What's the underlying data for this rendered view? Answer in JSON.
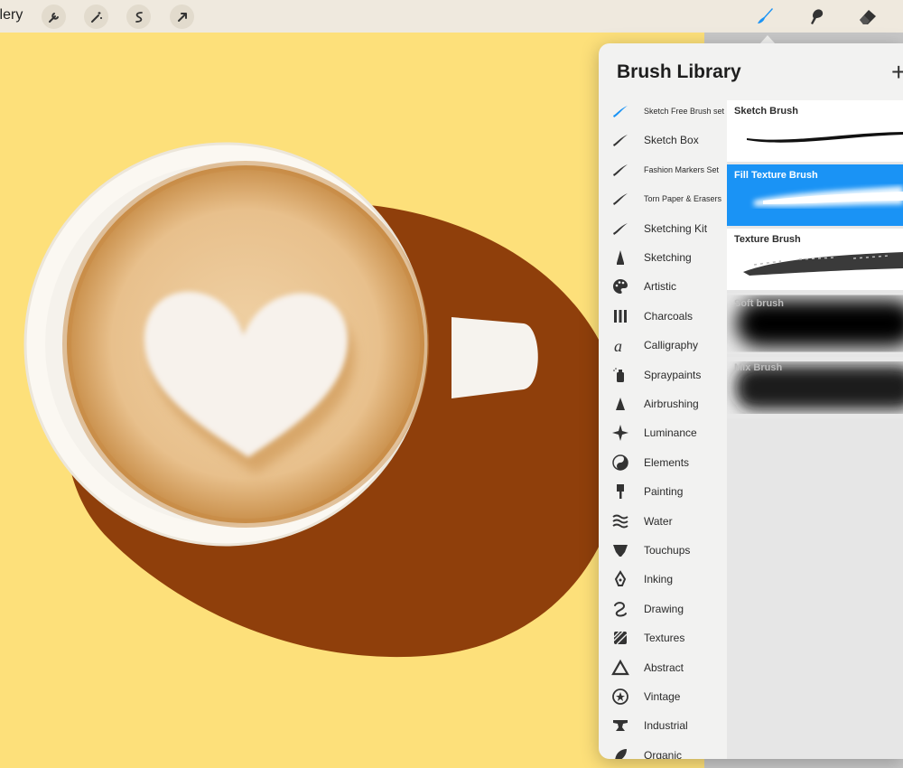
{
  "toolbar": {
    "gallery_label": "llery",
    "tools": [
      "wrench-icon",
      "magic-wand-icon",
      "selection-icon",
      "transform-arrow-icon"
    ],
    "right_tools": [
      "brush-icon",
      "smudge-icon",
      "eraser-icon"
    ],
    "active_color": "#1a93f5"
  },
  "panel": {
    "title": "Brush Library",
    "add_label": "+",
    "categories": [
      {
        "label": "Sketch Free Brush set",
        "icon": "brush-stroke-icon",
        "active": true
      },
      {
        "label": "Sketch Box",
        "icon": "brush-stroke-icon"
      },
      {
        "label": "Fashion Markers Set",
        "icon": "brush-stroke-icon"
      },
      {
        "label": "Torn Paper & Erasers",
        "icon": "brush-stroke-icon"
      },
      {
        "label": "Sketching Kit",
        "icon": "brush-stroke-icon"
      },
      {
        "label": "Sketching",
        "icon": "pencil-icon"
      },
      {
        "label": "Artistic",
        "icon": "palette-icon"
      },
      {
        "label": "Charcoals",
        "icon": "charcoal-icon"
      },
      {
        "label": "Calligraphy",
        "icon": "calligraphy-icon"
      },
      {
        "label": "Spraypaints",
        "icon": "spray-can-icon"
      },
      {
        "label": "Airbrushing",
        "icon": "airbrush-icon"
      },
      {
        "label": "Luminance",
        "icon": "sparkle-icon"
      },
      {
        "label": "Elements",
        "icon": "yin-yang-icon"
      },
      {
        "label": "Painting",
        "icon": "paintbrush-icon"
      },
      {
        "label": "Water",
        "icon": "waves-icon"
      },
      {
        "label": "Touchups",
        "icon": "touchup-icon"
      },
      {
        "label": "Inking",
        "icon": "pen-nib-icon"
      },
      {
        "label": "Drawing",
        "icon": "squiggle-icon"
      },
      {
        "label": "Textures",
        "icon": "texture-icon"
      },
      {
        "label": "Abstract",
        "icon": "triangle-icon"
      },
      {
        "label": "Vintage",
        "icon": "star-circle-icon"
      },
      {
        "label": "Industrial",
        "icon": "anvil-icon"
      },
      {
        "label": "Organic",
        "icon": "leaf-icon"
      }
    ],
    "brushes": [
      {
        "name": "Sketch Brush",
        "selected": false
      },
      {
        "name": "Fill Texture Brush",
        "selected": true
      },
      {
        "name": "Texture Brush",
        "selected": false
      },
      {
        "name": "Soft brush",
        "selected": false
      },
      {
        "name": "Mix Brush",
        "selected": false
      }
    ]
  }
}
